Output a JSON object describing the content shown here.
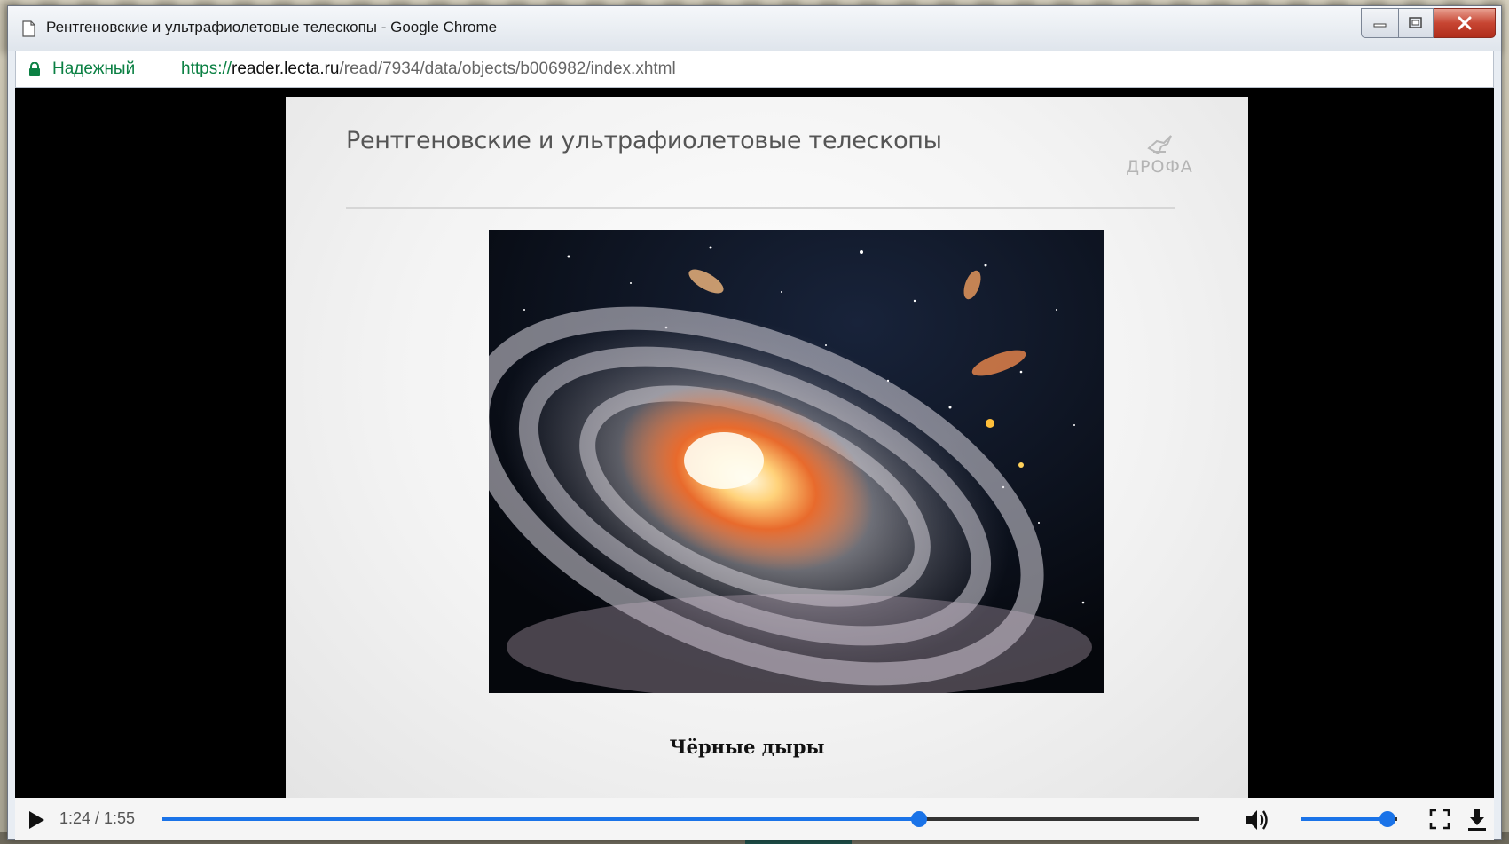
{
  "window": {
    "title": "Рентгеновские и ультрафиолетовые телескопы - Google Chrome"
  },
  "address_bar": {
    "security_label": "Надежный",
    "url_scheme": "https://",
    "url_host": "reader.lecta.ru",
    "url_path": "/read/7934/data/objects/b006982/index.xhtml"
  },
  "slide": {
    "title": "Рентгеновские и ультрафиолетовые телескопы",
    "logo_text": "ДРОФА",
    "caption": "Чёрные дыры"
  },
  "player": {
    "time_display": "1:24 / 1:55",
    "progress_fraction": 0.7304,
    "volume_fraction": 0.9
  },
  "colors": {
    "secure_green": "#0b8043",
    "accent_blue": "#1a73e8"
  }
}
